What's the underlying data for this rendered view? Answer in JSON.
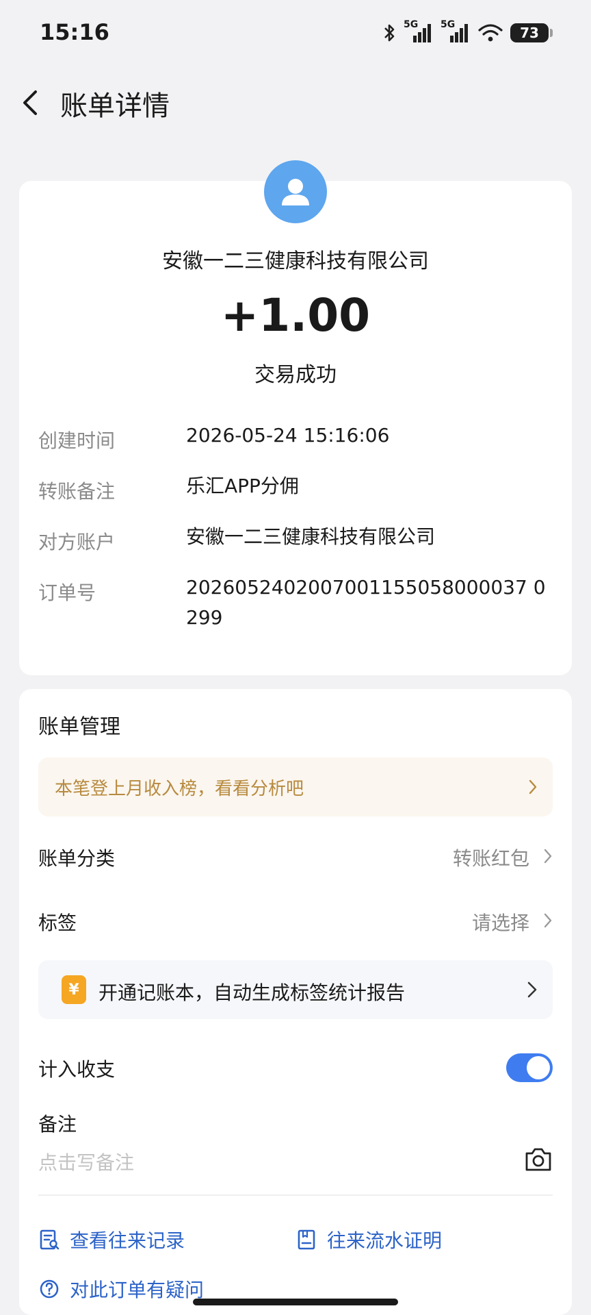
{
  "status_bar": {
    "time": "15:16",
    "battery": "73",
    "network_1": "5G",
    "network_2": "5G"
  },
  "header": {
    "title": "账单详情"
  },
  "summary": {
    "merchant": "安徽一二三健康科技有限公司",
    "amount": "+1.00",
    "status": "交易成功",
    "avatar_icon": "person-icon",
    "avatar_color": "#5ea6ee"
  },
  "details": [
    {
      "label": "创建时间",
      "value": "2026-05-24 15:16:06"
    },
    {
      "label": "转账备注",
      "value": "乐汇APP分佣"
    },
    {
      "label": "对方账户",
      "value": "安徽一二三健康科技有限公司"
    },
    {
      "label": "订单号",
      "value": "2026052402007001155058000037 0299"
    }
  ],
  "management": {
    "title": "账单管理",
    "banner": "本笔登上月收入榜，看看分析吧",
    "category_label": "账单分类",
    "category_value": "转账红包",
    "tag_label": "标签",
    "tag_value": "请选择",
    "promo_icon": "¥",
    "promo_text": "开通记账本，自动生成标签统计报告",
    "include_label": "计入收支",
    "include_enabled": true,
    "note_label": "备注",
    "note_placeholder": "点击写备注",
    "action_records": "查看往来记录",
    "action_proof": "往来流水证明",
    "action_question": "对此订单有疑问"
  },
  "colors": {
    "accent": "#3f7cf0",
    "link": "#2c63c8",
    "banner_text": "#b78a3f",
    "banner_bg": "#fbf6ef"
  }
}
